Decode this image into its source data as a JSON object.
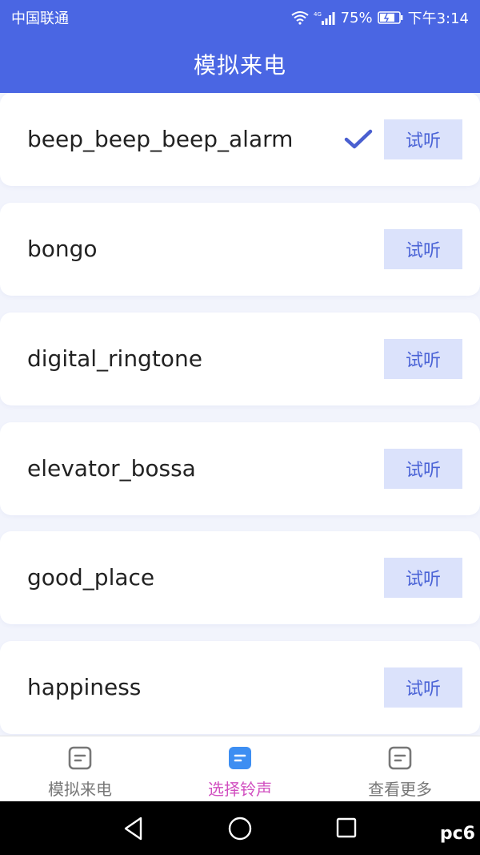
{
  "status_bar": {
    "carrier": "中国联通",
    "network": "4G",
    "battery": "75%",
    "time": "下午3:14"
  },
  "header": {
    "title": "模拟来电"
  },
  "ringtones": {
    "items": [
      {
        "name": "beep_beep_beep_alarm",
        "selected": true,
        "button_label": "试听"
      },
      {
        "name": "bongo",
        "selected": false,
        "button_label": "试听"
      },
      {
        "name": "digital_ringtone",
        "selected": false,
        "button_label": "试听"
      },
      {
        "name": "elevator_bossa",
        "selected": false,
        "button_label": "试听"
      },
      {
        "name": "good_place",
        "selected": false,
        "button_label": "试听"
      },
      {
        "name": "happiness",
        "selected": false,
        "button_label": "试听"
      }
    ],
    "selected_icon": "check-icon"
  },
  "tabs": [
    {
      "label": "模拟来电",
      "icon": "document-icon",
      "active": false
    },
    {
      "label": "选择铃声",
      "icon": "document-icon",
      "active": true
    },
    {
      "label": "查看更多",
      "icon": "document-icon",
      "active": false
    }
  ],
  "nav": {
    "watermark": "pc6"
  },
  "colors": {
    "primary": "#4a66e3",
    "button_bg": "#dbe2fb",
    "button_text": "#4a63d6",
    "active_tab": "#d14fc0",
    "check": "#4a5fd0"
  }
}
